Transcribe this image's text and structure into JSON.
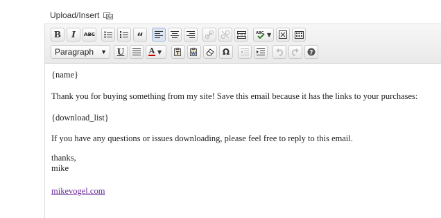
{
  "upload": {
    "label": "Upload/Insert",
    "icon": "media-icon"
  },
  "toolbar": {
    "row1": [
      {
        "name": "bold-button",
        "glyph": "B"
      },
      {
        "name": "italic-button",
        "glyph": "I"
      },
      {
        "name": "strikethrough-button",
        "glyph": "ABC"
      },
      {
        "name": "bullet-list-button",
        "icon": "bullet-list-icon"
      },
      {
        "name": "numbered-list-button",
        "icon": "numbered-list-icon"
      },
      {
        "name": "blockquote-button",
        "glyph": "“"
      },
      {
        "name": "align-left-button",
        "icon": "align-left-icon"
      },
      {
        "name": "align-center-button",
        "icon": "align-center-icon"
      },
      {
        "name": "align-right-button",
        "icon": "align-right-icon"
      },
      {
        "name": "insert-link-button",
        "icon": "link-icon"
      },
      {
        "name": "unlink-button",
        "icon": "unlink-icon"
      },
      {
        "name": "more-tag-button",
        "icon": "more-tag-icon"
      },
      {
        "name": "spellcheck-button",
        "icon": "spellcheck-icon"
      },
      {
        "name": "fullscreen-button",
        "icon": "fullscreen-icon"
      },
      {
        "name": "kitchen-sink-button",
        "icon": "kitchen-sink-icon"
      }
    ],
    "row2": {
      "format_select": "Paragraph",
      "buttons": [
        {
          "name": "underline-button",
          "glyph": "U"
        },
        {
          "name": "justify-button",
          "icon": "justify-icon"
        },
        {
          "name": "text-color-button",
          "glyph": "A"
        },
        {
          "name": "paste-text-button",
          "icon": "paste-text-icon"
        },
        {
          "name": "paste-word-button",
          "icon": "paste-word-icon"
        },
        {
          "name": "clear-formatting-button",
          "icon": "eraser-icon"
        },
        {
          "name": "special-character-button",
          "glyph": "Ω"
        },
        {
          "name": "outdent-button",
          "icon": "outdent-icon"
        },
        {
          "name": "indent-button",
          "icon": "indent-icon"
        },
        {
          "name": "undo-button",
          "icon": "undo-icon"
        },
        {
          "name": "redo-button",
          "icon": "redo-icon"
        },
        {
          "name": "help-button",
          "icon": "help-icon"
        }
      ]
    }
  },
  "content": {
    "line1": "{name}",
    "line2": "Thank you for buying something from my site! Save this email because it has the links to your purchases:",
    "line3": "{download_list}",
    "line4": "If you have any questions or issues downloading, please feel free to reply to this email.",
    "line5a": "thanks,",
    "line5b": "mike",
    "link": "mikevogel.com"
  },
  "colors": {
    "link": "#6a2a9a",
    "active_button": "#dbe5f2",
    "text_color_swatch": "#c00000"
  }
}
